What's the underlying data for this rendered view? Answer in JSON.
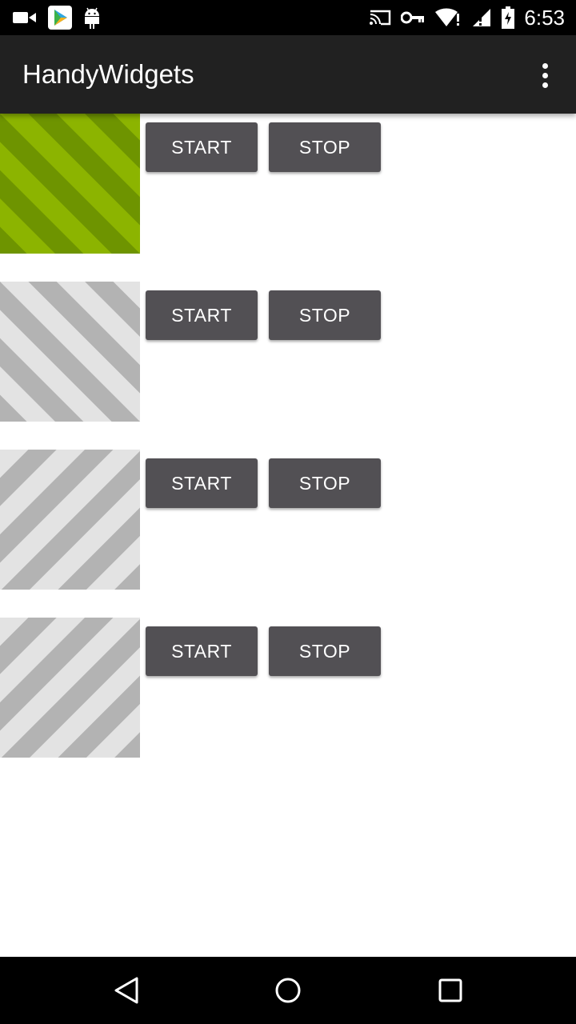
{
  "status_bar": {
    "time": "6:53",
    "left_icons": [
      "videocam-icon",
      "play-store-icon",
      "android-icon"
    ],
    "right_icons": [
      "cast-icon",
      "vpn-key-icon",
      "wifi-icon",
      "signal-icon",
      "battery-icon"
    ]
  },
  "app_bar": {
    "title": "HandyWidgets",
    "overflow_icon": "more-vert-icon",
    "background": "#212121"
  },
  "widgets": [
    {
      "image_color": "green",
      "start_label": "START",
      "stop_label": "STOP"
    },
    {
      "image_color": "gray",
      "start_label": "START",
      "stop_label": "STOP"
    },
    {
      "image_color": "gray",
      "start_label": "START",
      "stop_label": "STOP"
    },
    {
      "image_color": "gray",
      "start_label": "START",
      "stop_label": "STOP"
    }
  ],
  "colors": {
    "button": "#525054",
    "stripe_green_light": "#8cb400",
    "stripe_green_dark": "#6e9400",
    "stripe_gray_light": "#e3e3e3",
    "stripe_gray_dark": "#b3b3b3"
  },
  "nav_bar": {
    "icons": [
      "back-icon",
      "home-icon",
      "recents-icon"
    ]
  }
}
